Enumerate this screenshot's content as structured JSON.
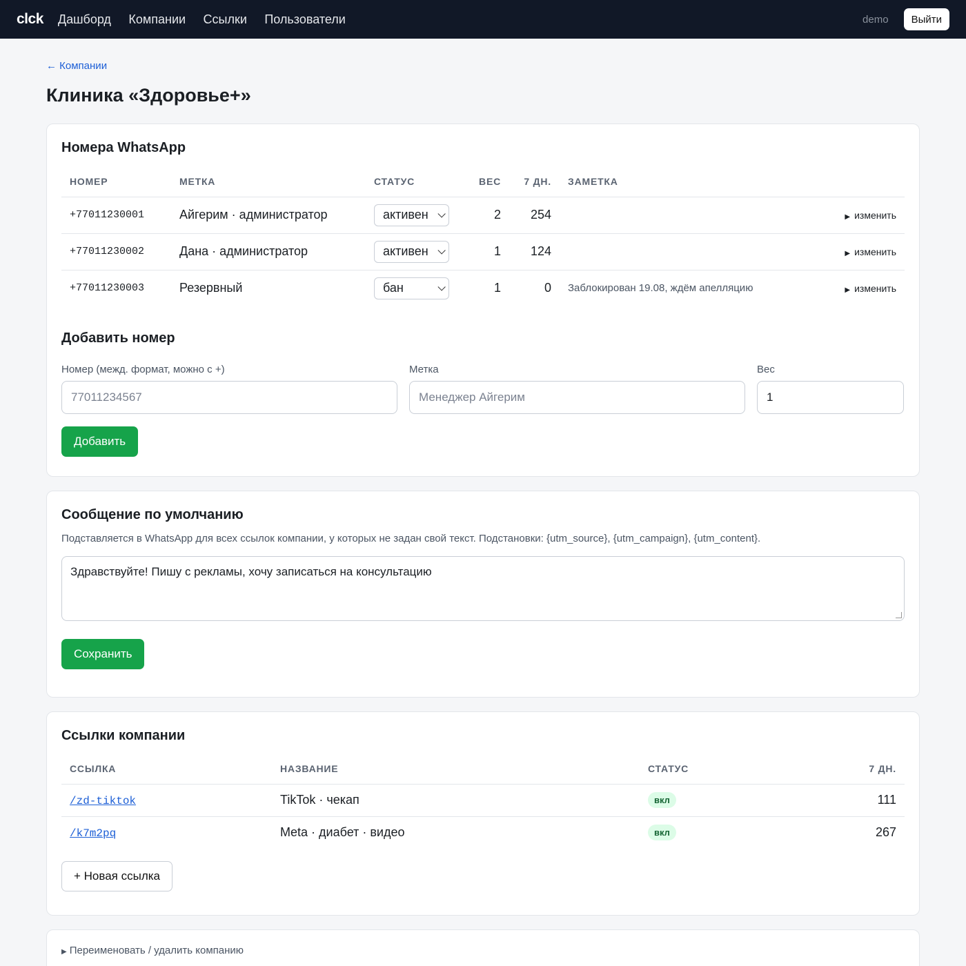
{
  "topbar": {
    "logo": "clck",
    "nav": [
      "Дашборд",
      "Компании",
      "Ссылки",
      "Пользователи"
    ],
    "user": "demo",
    "logout_label": "Выйти"
  },
  "back_label": "← Компании",
  "page_title": "Клиника «Здоровье+»",
  "numbers": {
    "title": "Номера WhatsApp",
    "columns": [
      "НОМЕР",
      "МЕТКА",
      "СТАТУС",
      "ВЕС",
      "7 ДН.",
      "ЗАМЕТКА"
    ],
    "rows": [
      {
        "number": "+77011230001",
        "label": "Айгерим · администратор",
        "status": "активен",
        "weight": "2",
        "days7": "254",
        "note": "",
        "edit": "изменить"
      },
      {
        "number": "+77011230002",
        "label": "Дана · администратор",
        "status": "активен",
        "weight": "1",
        "days7": "124",
        "note": "",
        "edit": "изменить"
      },
      {
        "number": "+77011230003",
        "label": "Резервный",
        "status": "бан",
        "weight": "1",
        "days7": "0",
        "note": "Заблокирован 19.08, ждём апелляцию",
        "edit": "изменить"
      }
    ]
  },
  "add_number": {
    "title": "Добавить номер",
    "number_label": "Номер (межд. формат, можно с +)",
    "number_placeholder": "77011234567",
    "tag_label": "Метка",
    "tag_placeholder": "Менеджер Айгерим",
    "weight_label": "Вес",
    "weight_value": "1",
    "submit_label": "Добавить"
  },
  "default_message": {
    "title": "Сообщение по умолчанию",
    "help": "Подставляется в WhatsApp для всех ссылок компании, у которых не задан свой текст. Подстановки: {utm_source}, {utm_campaign}, {utm_content}.",
    "text": "Здравствуйте! Пишу с рекламы, хочу записаться на консультацию",
    "save_label": "Сохранить"
  },
  "links": {
    "title": "Ссылки компании",
    "columns": [
      "ССЫЛКА",
      "НАЗВАНИЕ",
      "СТАТУС",
      "7 ДН."
    ],
    "rows": [
      {
        "slug": "/zd-tiktok",
        "name": "TikTok · чекап",
        "status": "вкл",
        "days7": "111"
      },
      {
        "slug": "/k7m2pq",
        "name": "Meta · диабет · видео",
        "status": "вкл",
        "days7": "267"
      }
    ],
    "new_label": "+ Новая ссылка"
  },
  "manage": {
    "label": "Переименовать / удалить компанию"
  }
}
